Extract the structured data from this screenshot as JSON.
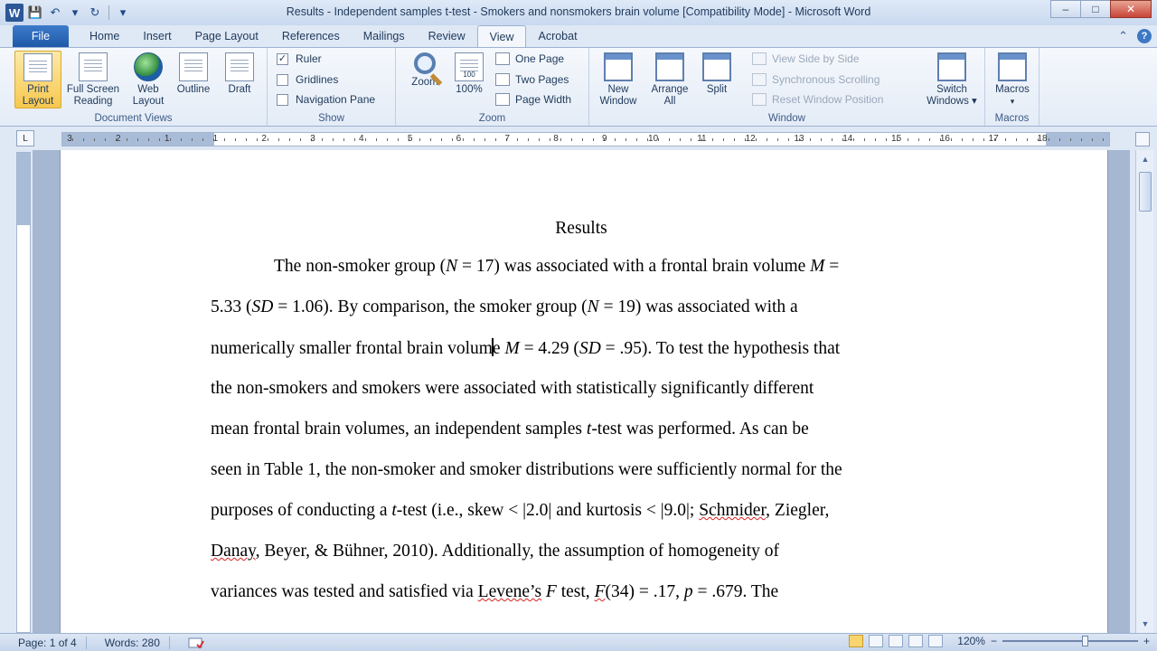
{
  "window": {
    "title": "Results - Independent samples t-test - Smokers and nonsmokers brain volume [Compatibility Mode]  -  Microsoft Word",
    "minimize": "–",
    "maximize": "□",
    "close": "✕"
  },
  "qat": {
    "logo": "W",
    "save": "💾",
    "undo": "↶",
    "undo_drop": "▾",
    "redo": "↻",
    "customize": "▾"
  },
  "tabs": [
    "File",
    "Home",
    "Insert",
    "Page Layout",
    "References",
    "Mailings",
    "Review",
    "View",
    "Acrobat"
  ],
  "active_tab": "View",
  "tabs_right": {
    "minimize_ribbon": "⌃",
    "help": "?"
  },
  "ribbon": {
    "document_views": {
      "label": "Document Views",
      "print_layout": "Print Layout",
      "full_screen_reading": "Full Screen Reading",
      "web_layout": "Web Layout",
      "outline": "Outline",
      "draft": "Draft"
    },
    "show": {
      "label": "Show",
      "ruler": "Ruler",
      "gridlines": "Gridlines",
      "navigation_pane": "Navigation Pane",
      "ruler_checked": "✓"
    },
    "zoom": {
      "label": "Zoom",
      "zoom": "Zoom",
      "hundred": "100%",
      "hundred_icon": "100",
      "one_page": "One Page",
      "two_pages": "Two Pages",
      "page_width": "Page Width"
    },
    "window": {
      "label": "Window",
      "new_window": "New Window",
      "arrange_all": "Arrange All",
      "split": "Split",
      "view_side_by_side": "View Side by Side",
      "synchronous_scrolling": "Synchronous Scrolling",
      "reset_window_position": "Reset Window Position",
      "switch_windows": "Switch Windows",
      "switch_drop": "▾"
    },
    "macros": {
      "label": "Macros",
      "macros": "Macros",
      "drop": "▾"
    }
  },
  "ruler": {
    "toggle": "L",
    "numbers": [
      "3",
      "2",
      "1",
      "1",
      "2",
      "3",
      "4",
      "5",
      "6",
      "7",
      "8",
      "9",
      "10",
      "11",
      "12",
      "13",
      "14",
      "15",
      "16",
      "17",
      "18"
    ]
  },
  "document": {
    "heading": "Results",
    "lines": [
      {
        "parts": [
          {
            "t": "The non-smoker group ("
          },
          {
            "t": "N",
            "i": true
          },
          {
            "t": " = 17) was associated with a frontal brain volume "
          },
          {
            "t": "M",
            "i": true
          },
          {
            "t": " ="
          }
        ],
        "indent": true
      },
      {
        "parts": [
          {
            "t": "5.33 ("
          },
          {
            "t": "SD",
            "i": true
          },
          {
            "t": " = 1.06). By comparison, the smoker group ("
          },
          {
            "t": "N",
            "i": true
          },
          {
            "t": " = 19) was associated with a"
          }
        ]
      },
      {
        "parts": [
          {
            "t": "numerically smaller frontal brain volum"
          },
          {
            "caret": true
          },
          {
            "t": "e "
          },
          {
            "t": "M",
            "i": true
          },
          {
            "t": " = 4.29 ("
          },
          {
            "t": "SD",
            "i": true
          },
          {
            "t": " = .95). To test the hypothesis that"
          }
        ]
      },
      {
        "parts": [
          {
            "t": "the non-smokers and smokers were associated with statistically significantly different"
          }
        ]
      },
      {
        "parts": [
          {
            "t": "mean frontal brain volumes, an independent samples "
          },
          {
            "t": "t",
            "i": true
          },
          {
            "t": "-test was performed. As can be"
          }
        ]
      },
      {
        "parts": [
          {
            "t": "seen in Table 1, the non-smoker and smoker distributions were sufficiently normal for the"
          }
        ]
      },
      {
        "parts": [
          {
            "t": "purposes of conducting a "
          },
          {
            "t": "t",
            "i": true
          },
          {
            "t": "-test (i.e., skew < |2.0| and kurtosis < |9.0|; "
          },
          {
            "t": "Schmider",
            "sq": true
          },
          {
            "t": ", Ziegler,"
          }
        ]
      },
      {
        "parts": [
          {
            "t": "Danay",
            "sq": true
          },
          {
            "t": ", Beyer, & Bühner, 2010). Additionally, the assumption of homogeneity of"
          }
        ]
      },
      {
        "parts": [
          {
            "t": "variances was tested and satisfied via "
          },
          {
            "t": "Levene’s",
            "sq": true
          },
          {
            "t": " "
          },
          {
            "t": "F",
            "i": true
          },
          {
            "t": " test, "
          },
          {
            "t": "F",
            "i": true,
            "sq": true
          },
          {
            "t": "(34) = .17, "
          },
          {
            "t": "p",
            "i": true
          },
          {
            "t": " = .679. The"
          }
        ]
      }
    ]
  },
  "statusbar": {
    "page": "Page: 1 of 4",
    "words": "Words: 280",
    "zoom": "120%",
    "zoom_out": "−",
    "zoom_in": "+"
  },
  "scrollbar": {
    "up": "▲",
    "down": "▼"
  }
}
